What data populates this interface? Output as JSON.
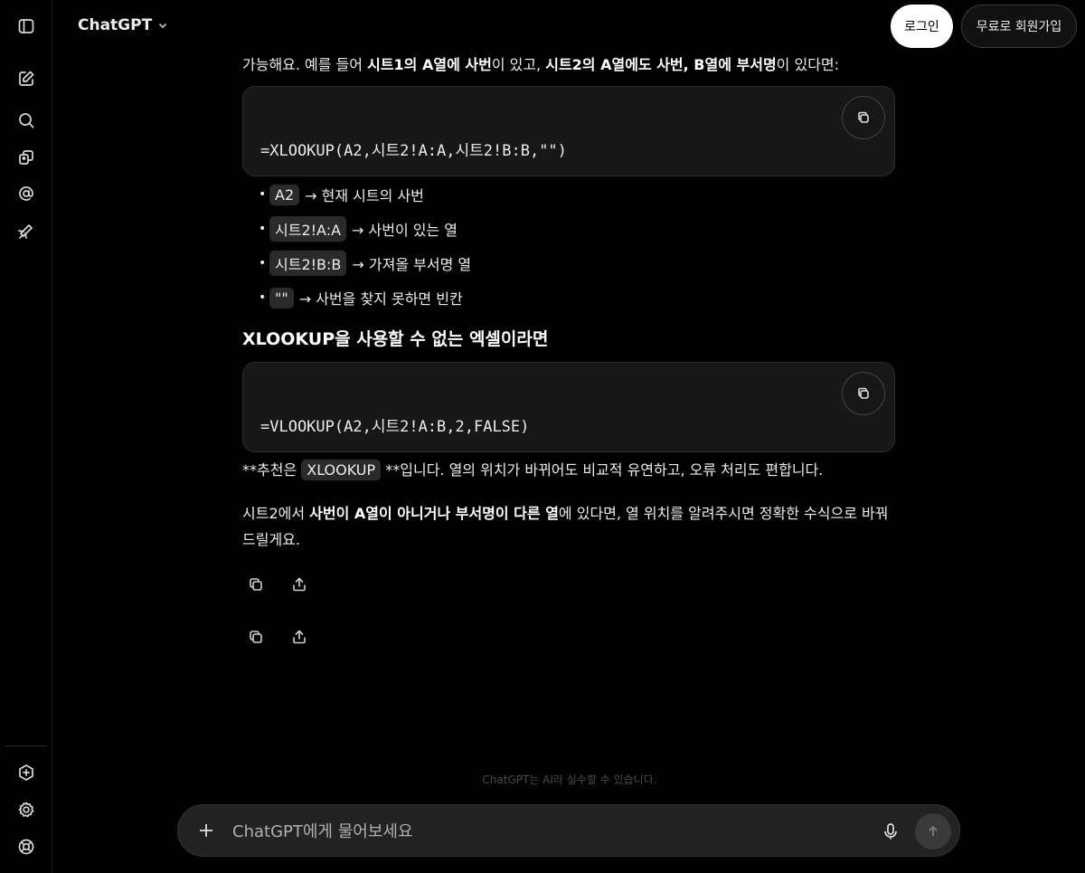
{
  "header": {
    "model_name": "ChatGPT",
    "login_label": "로그인",
    "signup_label": "무료로 회원가입"
  },
  "sidebar": {
    "icons": [
      "sidebar-toggle-icon",
      "new-chat-icon",
      "search-icon",
      "library-icon",
      "at-sign-icon",
      "explore-icon"
    ],
    "bottom_icons": [
      "upgrade-icon",
      "settings-icon",
      "help-icon"
    ]
  },
  "message": {
    "intro": {
      "t1": "가능해요. 예를 들어 ",
      "b1": "시트1의 A열에 사번",
      "t2": "이 있고, ",
      "b2": "시트2의 A열에도 사번, B열에 부서명",
      "t3": "이 있다면:"
    },
    "code1": "=XLOOKUP(A2,시트2!A:A,시트2!B:B,\"\")",
    "bullets": [
      {
        "code": "A2",
        "text": "→ 현재 시트의 사번"
      },
      {
        "code": "시트2!A:A",
        "text": "→ 사번이 있는 열"
      },
      {
        "code": "시트2!B:B",
        "text": "→ 가져올 부서명 열"
      },
      {
        "code": "\"\"",
        "text": "→ 사번을 찾지 못하면 빈칸"
      }
    ],
    "heading": "XLOOKUP을 사용할 수 없는 엑셀이라면",
    "code2": "=VLOOKUP(A2,시트2!A:B,2,FALSE)",
    "recommend": {
      "t1": "**추천은 ",
      "code": "XLOOKUP",
      "t2": " **입니다. 열의 위치가 바뀌어도 비교적 유연하고, 오류 처리도 편합니다."
    },
    "final": {
      "t1": "시트2에서 ",
      "b1": "사번이 A열이 아니거나 부서명이 다른 열",
      "t2": "에 있다면, 열 위치를 알려주시면 정확한 수식으로 바꿔드릴게요."
    }
  },
  "disclaimer": "ChatGPT는 AI라 실수할 수 있습니다.",
  "composer": {
    "placeholder": "ChatGPT에게 물어보세요"
  }
}
